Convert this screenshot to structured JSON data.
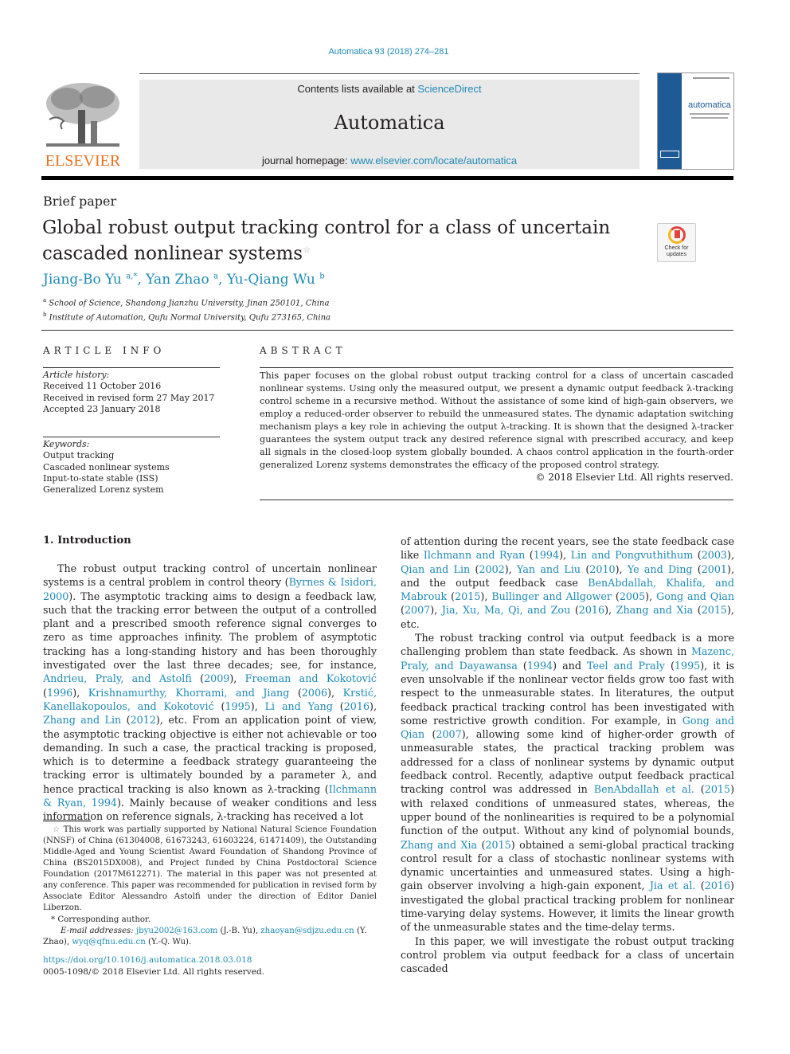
{
  "header": {
    "citation": "Automatica 93 (2018) 274–281",
    "contents_prefix": "Contents lists available at ",
    "contents_link": "ScienceDirect",
    "journal_name": "Automatica",
    "homepage_prefix": "journal homepage: ",
    "homepage_link": "www.elsevier.com/locate/automatica",
    "publisher_wordmark": "ELSEVIER",
    "cover_title": "automatica",
    "colors": {
      "link": "#1f8ab5",
      "elsevier_orange": "#e9711c",
      "cover_blue": "#1e5a96",
      "banner_gray": "#e9e9e9"
    }
  },
  "article": {
    "type": "Brief paper",
    "title": "Global robust output tracking control for a class of uncertain cascaded nonlinear systems",
    "title_footnote_mark": "☆",
    "check_updates": [
      "Check for",
      "updates"
    ],
    "authors": [
      {
        "name": "Jiang-Bo Yu",
        "marks": "a,*"
      },
      {
        "name": "Yan Zhao",
        "marks": "a"
      },
      {
        "name": "Yu-Qiang Wu",
        "marks": "b"
      }
    ],
    "affiliations": [
      {
        "mark": "a",
        "text": "School of Science, Shandong Jianzhu University, Jinan 250101, China"
      },
      {
        "mark": "b",
        "text": "Institute of Automation, Qufu Normal University, Qufu 273165, China"
      }
    ]
  },
  "article_info": {
    "heading": "ARTICLE INFO",
    "history_label": "Article history:",
    "history": [
      "Received 11 October 2016",
      "Received in revised form 27 May 2017",
      "Accepted 23 January 2018"
    ],
    "keywords_label": "Keywords:",
    "keywords": [
      "Output tracking",
      "Cascaded nonlinear systems",
      "Input-to-state stable (ISS)",
      "Generalized Lorenz system"
    ]
  },
  "abstract": {
    "heading": "ABSTRACT",
    "text": "This paper focuses on the global robust output tracking control for a class of uncertain cascaded nonlinear systems. Using only the measured output, we present a dynamic output feedback λ-tracking control scheme in a recursive method. Without the assistance of some kind of high-gain observers, we employ a reduced-order observer to rebuild the unmeasured states. The dynamic adaptation switching mechanism plays a key role in achieving the output λ-tracking. It is shown that the designed λ-tracker guarantees the system output track any desired reference signal with prescribed accuracy, and keep all signals in the closed-loop system globally bounded. A chaos control application in the fourth-order generalized Lorenz systems demonstrates the efficacy of the proposed control strategy.",
    "copyright": "© 2018 Elsevier Ltd. All rights reserved."
  },
  "introduction": {
    "heading": "1.  Introduction",
    "left_paragraph": [
      {
        "t": "The robust output tracking control of uncertain nonlinear systems is a central problem in control theory ("
      },
      {
        "l": "Byrnes & Isidori, 2000"
      },
      {
        "t": "). The asymptotic tracking aims to design a feedback law, such that the tracking error between the output of a controlled plant and a prescribed smooth reference signal converges to zero as time approaches infinity. The problem of asymptotic tracking has a long-standing history and has been thoroughly investigated over the last three decades; see, for instance, "
      },
      {
        "l": "Andrieu, Praly, and Astolfi"
      },
      {
        "t": " ("
      },
      {
        "l": "2009"
      },
      {
        "t": "), "
      },
      {
        "l": "Freeman and Kokotović"
      },
      {
        "t": " ("
      },
      {
        "l": "1996"
      },
      {
        "t": "), "
      },
      {
        "l": "Krishnamurthy, Khorrami, and Jiang"
      },
      {
        "t": " ("
      },
      {
        "l": "2006"
      },
      {
        "t": "), "
      },
      {
        "l": "Krstić, Kanellakopoulos, and Kokotović"
      },
      {
        "t": " ("
      },
      {
        "l": "1995"
      },
      {
        "t": "), "
      },
      {
        "l": "Li and Yang"
      },
      {
        "t": " ("
      },
      {
        "l": "2016"
      },
      {
        "t": "), "
      },
      {
        "l": "Zhang and Lin"
      },
      {
        "t": " ("
      },
      {
        "l": "2012"
      },
      {
        "t": "), etc. From an application point of view, the asymptotic tracking objective is either not achievable or too demanding. In such a case, the practical tracking is proposed, which is to determine a feedback strategy guaranteeing the tracking error is ultimately bounded by a parameter λ, and hence practical tracking is also known as λ-tracking ("
      },
      {
        "l": "Ilchmann & Ryan, 1994"
      },
      {
        "t": "). Mainly because of weaker conditions and less information on reference signals, λ-tracking has received a lot"
      }
    ],
    "right_paragraphs": [
      {
        "indent": false,
        "parts": [
          {
            "t": "of attention during the recent years, see the state feedback case like "
          },
          {
            "l": "Ilchmann and Ryan"
          },
          {
            "t": " ("
          },
          {
            "l": "1994"
          },
          {
            "t": "), "
          },
          {
            "l": "Lin and Pongvuthithum"
          },
          {
            "t": " ("
          },
          {
            "l": "2003"
          },
          {
            "t": "), "
          },
          {
            "l": "Qian and Lin"
          },
          {
            "t": " ("
          },
          {
            "l": "2002"
          },
          {
            "t": "), "
          },
          {
            "l": "Yan and Liu"
          },
          {
            "t": " ("
          },
          {
            "l": "2010"
          },
          {
            "t": "), "
          },
          {
            "l": "Ye and Ding"
          },
          {
            "t": " ("
          },
          {
            "l": "2001"
          },
          {
            "t": "), and the output feedback case "
          },
          {
            "l": "BenAbdallah, Khalifa, and Mabrouk"
          },
          {
            "t": " ("
          },
          {
            "l": "2015"
          },
          {
            "t": "), "
          },
          {
            "l": "Bullinger and Allgower"
          },
          {
            "t": " ("
          },
          {
            "l": "2005"
          },
          {
            "t": "), "
          },
          {
            "l": "Gong and Qian"
          },
          {
            "t": " ("
          },
          {
            "l": "2007"
          },
          {
            "t": "), "
          },
          {
            "l": "Jia, Xu, Ma, Qi, and Zou"
          },
          {
            "t": " ("
          },
          {
            "l": "2016"
          },
          {
            "t": "), "
          },
          {
            "l": "Zhang and Xia"
          },
          {
            "t": " ("
          },
          {
            "l": "2015"
          },
          {
            "t": "), etc."
          }
        ]
      },
      {
        "indent": true,
        "parts": [
          {
            "t": "The robust tracking control via output feedback is a more challenging problem than state feedback. As shown in "
          },
          {
            "l": "Mazenc, Praly, and Dayawansa"
          },
          {
            "t": " ("
          },
          {
            "l": "1994"
          },
          {
            "t": ") and "
          },
          {
            "l": "Teel and Praly"
          },
          {
            "t": " ("
          },
          {
            "l": "1995"
          },
          {
            "t": "), it is even unsolvable if the nonlinear vector fields grow too fast with respect to the unmeasurable states. In literatures, the output feedback practical tracking control has been investigated with some restrictive growth condition. For example, in "
          },
          {
            "l": "Gong and Qian"
          },
          {
            "t": " ("
          },
          {
            "l": "2007"
          },
          {
            "t": "), allowing some kind of higher-order growth of unmeasurable states, the practical tracking problem was addressed for a class of nonlinear systems by dynamic output feedback control. Recently, adaptive output feedback practical tracking control was addressed in "
          },
          {
            "l": "BenAbdallah et al."
          },
          {
            "t": " ("
          },
          {
            "l": "2015"
          },
          {
            "t": ") with relaxed conditions of unmeasured states, whereas, the upper bound of the nonlinearities is required to be a polynomial function of the output. Without any kind of polynomial bounds, "
          },
          {
            "l": "Zhang and Xia"
          },
          {
            "t": " ("
          },
          {
            "l": "2015"
          },
          {
            "t": ") obtained a semi-global practical tracking control result for a class of stochastic nonlinear systems with dynamic uncertainties and unmeasured states. Using a high-gain observer involving a high-gain exponent, "
          },
          {
            "l": "Jia et al."
          },
          {
            "t": " ("
          },
          {
            "l": "2016"
          },
          {
            "t": ") investigated the global practical tracking problem for nonlinear time-varying delay systems. However, it limits the linear growth of the unmeasurable states and the time-delay terms."
          }
        ]
      },
      {
        "indent": true,
        "parts": [
          {
            "t": "In this paper, we will investigate the robust output tracking control problem via output feedback for a class of uncertain cascaded"
          }
        ]
      }
    ]
  },
  "footnotes": {
    "funding_mark": "☆",
    "funding": "This work was partially supported by National Natural Science Foundation (NNSF) of China (61304008, 61673243, 61603224, 61471409), the Outstanding Middle-Aged and Young Scientist Award Foundation of Shandong Province of China (BS2015DX008), and Project funded by China Postdoctoral Science Foundation (2017M612271). The material in this paper was not presented at any conference. This paper was recommended for publication in revised form by Associate Editor Alessandro Astolfi under the direction of Editor Daniel Liberzon.",
    "corresponding_mark": "*",
    "corresponding": "Corresponding author.",
    "email_label": "E-mail addresses:",
    "emails": [
      {
        "address": "jbyu2002@163.com",
        "who": "(J.-B. Yu)"
      },
      {
        "address": "zhaoyan@sdjzu.edu.cn",
        "who": "(Y. Zhao)"
      },
      {
        "address": "wyq@qfnu.edu.cn",
        "who": "(Y.-Q. Wu)."
      }
    ],
    "doi": "https://doi.org/10.1016/j.automatica.2018.03.018",
    "issn": "0005-1098/© 2018 Elsevier Ltd. All rights reserved."
  }
}
